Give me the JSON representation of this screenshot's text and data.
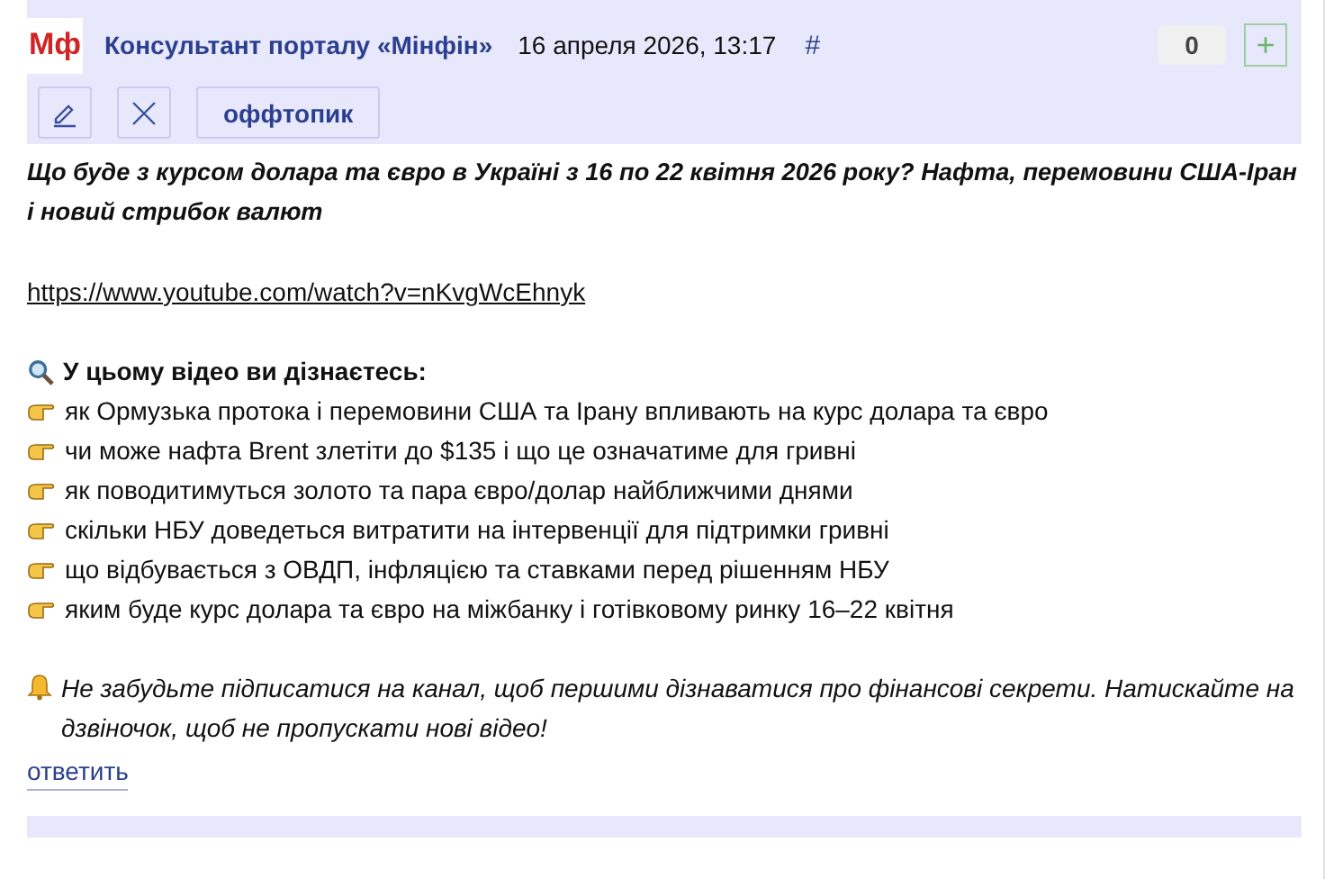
{
  "post": {
    "logo": "Мф",
    "author": "Консультант порталу «Мінфін»",
    "date": "16 апреля 2026, 13:17",
    "anchor": "#",
    "score": "0",
    "plus": "+",
    "tag": "оффтопик"
  },
  "title_lines": [
    "Що буде з курсом долара та євро в Україні з 16 по 22 квітня 2026 року? Нафта, перемовини США-Іран і новий стрибок валют"
  ],
  "link": "https://www.youtube.com/watch?v=nKvgWcEhnyk",
  "intro": "У цьому відео ви дізнаєтесь:",
  "bullets": [
    "як Ормузька протока і перемовини США та Ірану впливають на курс долара та євро",
    "чи може нафта Brent злетіти до $135 і що це означатиме для гривні",
    "як поводитимуться золото та пара євро/долар найближчими днями",
    "скільки НБУ доведеться витратити на інтервенції для підтримки гривні",
    "що відбувається з ОВДП, інфляцією та ставками перед рішенням НБУ",
    "яким буде курс долара та євро на міжбанку і готівковому ринку 16–22 квітня"
  ],
  "outro": "Не забудьте підписатися на канал, щоб першими дізнаватися про фінансові секрети. Натискайте на дзвіночок, щоб не пропускати нові відео!",
  "reply": "ответить"
}
